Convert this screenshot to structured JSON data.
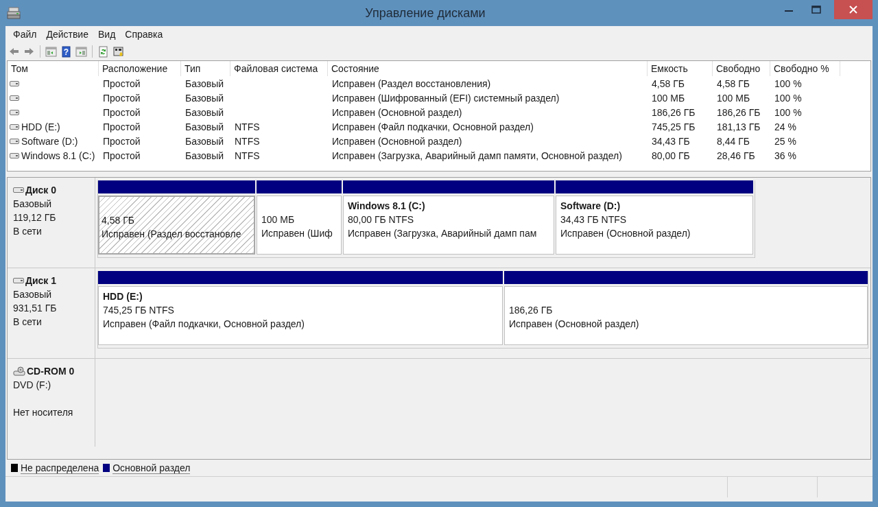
{
  "window": {
    "title": "Управление дисками"
  },
  "menu": [
    "Файл",
    "Действие",
    "Вид",
    "Справка"
  ],
  "toolbar": [
    {
      "kind": "back"
    },
    {
      "kind": "forward"
    },
    {
      "kind": "sep"
    },
    {
      "kind": "tree"
    },
    {
      "kind": "help",
      "glyph": "?"
    },
    {
      "kind": "pane"
    },
    {
      "kind": "sep"
    },
    {
      "kind": "refresh"
    },
    {
      "kind": "props"
    }
  ],
  "table": {
    "columns": [
      "Том",
      "Расположение",
      "Тип",
      "Файловая система",
      "Состояние",
      "Емкость",
      "Свободно",
      "Свободно %"
    ],
    "rows": [
      [
        "",
        "Простой",
        "Базовый",
        "",
        "Исправен (Раздел восстановления)",
        "4,58 ГБ",
        "4,58 ГБ",
        "100 %"
      ],
      [
        "",
        "Простой",
        "Базовый",
        "",
        "Исправен (Шифрованный (EFI) системный раздел)",
        "100 МБ",
        "100 МБ",
        "100 %"
      ],
      [
        "",
        "Простой",
        "Базовый",
        "",
        "Исправен (Основной раздел)",
        "186,26 ГБ",
        "186,26 ГБ",
        "100 %"
      ],
      [
        "HDD (E:)",
        "Простой",
        "Базовый",
        "NTFS",
        "Исправен (Файл подкачки, Основной раздел)",
        "745,25 ГБ",
        "181,13 ГБ",
        "24 %"
      ],
      [
        "Software (D:)",
        "Простой",
        "Базовый",
        "NTFS",
        "Исправен (Основной раздел)",
        "34,43 ГБ",
        "8,44 ГБ",
        "25 %"
      ],
      [
        "Windows 8.1 (C:)",
        "Простой",
        "Базовый",
        "NTFS",
        "Исправен (Загрузка, Аварийный дамп памяти, Основной раздел)",
        "80,00 ГБ",
        "28,46 ГБ",
        "36 %"
      ]
    ]
  },
  "disks": [
    {
      "kind": "disk",
      "name": "Диск 0",
      "lines": [
        "Базовый",
        "119,12 ГБ",
        "В сети"
      ],
      "partitions": [
        {
          "size": "4,58 ГБ",
          "status": "Исправен (Раздел восстановле",
          "selected": true
        },
        {
          "size": "100 МБ",
          "status": "Исправен (Шиф",
          "selected": false
        },
        {
          "name": "Windows 8.1  (C:)",
          "size": "80,00 ГБ NTFS",
          "status": "Исправен (Загрузка, Аварийный дамп пам",
          "selected": false
        },
        {
          "name": "Software  (D:)",
          "size": "34,43 ГБ NTFS",
          "status": "Исправен (Основной раздел)",
          "selected": false
        }
      ]
    },
    {
      "kind": "disk",
      "name": "Диск 1",
      "lines": [
        "Базовый",
        "931,51 ГБ",
        "В сети"
      ],
      "partitions": [
        {
          "name": "HDD  (E:)",
          "size": "745,25 ГБ NTFS",
          "status": "Исправен (Файл подкачки, Основной раздел)",
          "selected": false
        },
        {
          "size": "186,26 ГБ",
          "status": "Исправен (Основной раздел)",
          "selected": false
        }
      ]
    },
    {
      "kind": "cdrom",
      "name": "CD-ROM 0",
      "lines": [
        "DVD (F:)",
        "Нет носителя"
      ]
    }
  ],
  "legend": [
    {
      "label": "Не распределена",
      "color": "#000000"
    },
    {
      "label": "Основной раздел",
      "color": "#000080"
    }
  ]
}
